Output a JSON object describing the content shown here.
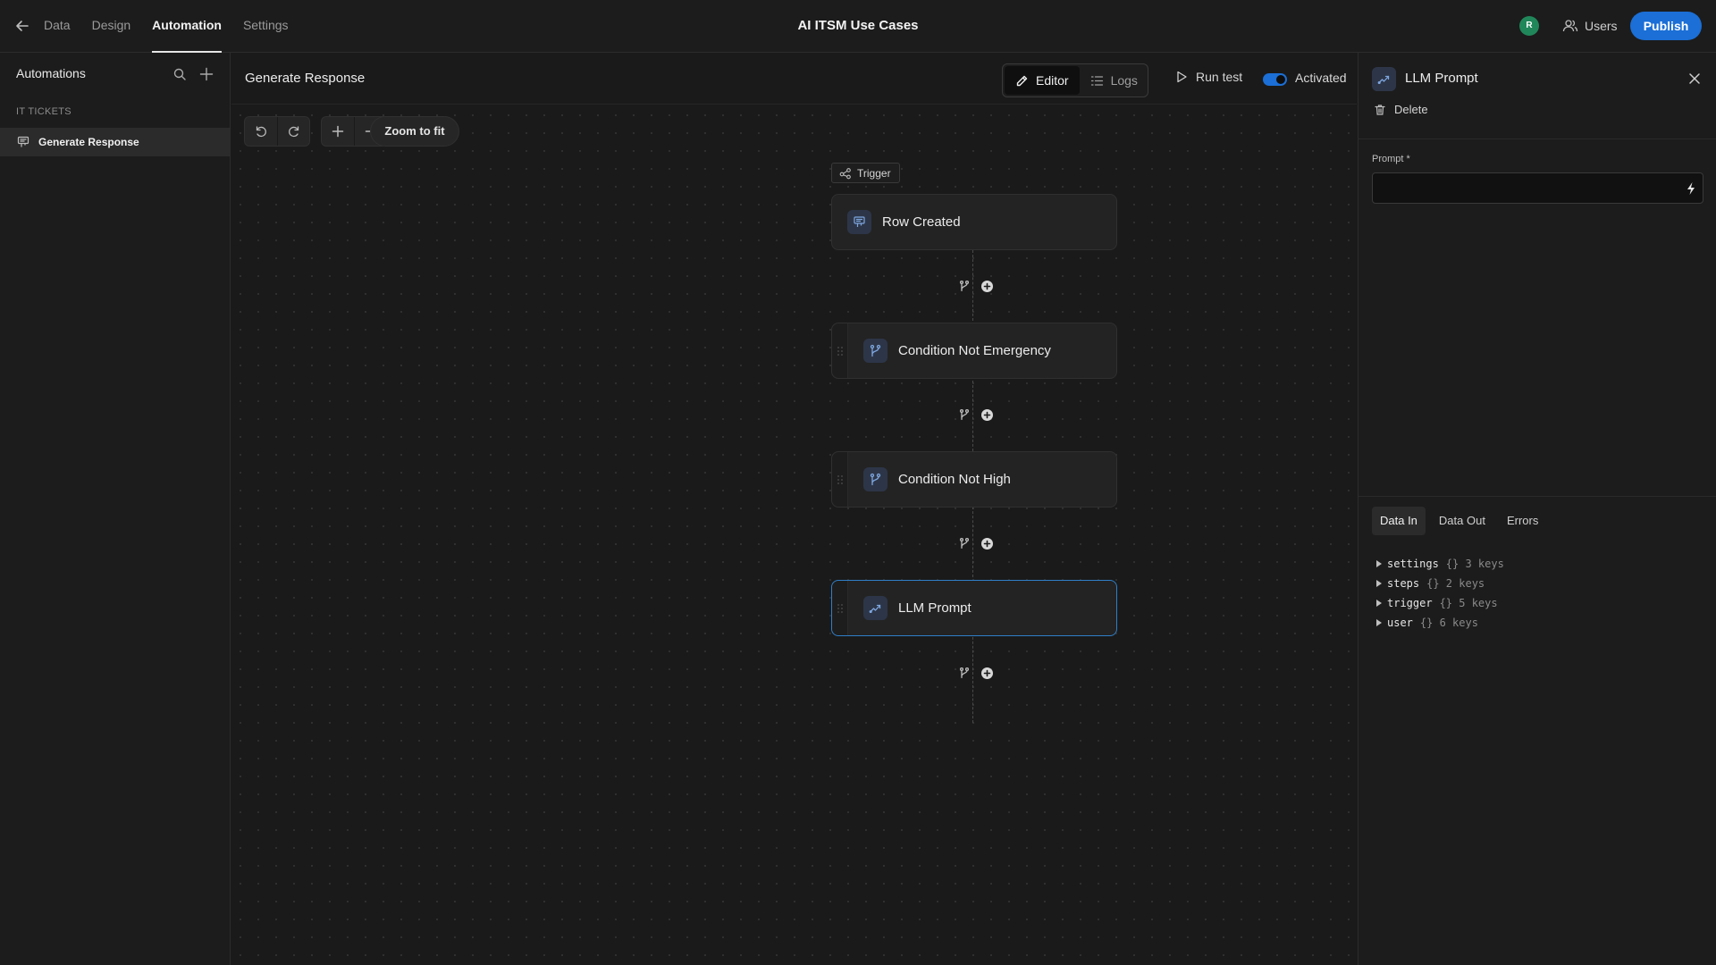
{
  "header": {
    "title": "AI ITSM Use Cases",
    "nav_tabs": [
      "Data",
      "Design",
      "Automation",
      "Settings"
    ],
    "active_tab": "Automation",
    "avatar_initial": "R",
    "users_label": "Users",
    "publish_label": "Publish"
  },
  "sidebar": {
    "title": "Automations",
    "section": "IT TICKETS",
    "items": [
      {
        "label": "Generate Response"
      }
    ]
  },
  "canvas": {
    "title": "Generate Response",
    "editor_label": "Editor",
    "logs_label": "Logs",
    "run_test_label": "Run test",
    "activated_label": "Activated",
    "activated": true,
    "zoom_to_fit_label": "Zoom to fit",
    "trigger_tag": "Trigger",
    "nodes": [
      {
        "label": "Row Created",
        "icon": "table-row-icon"
      },
      {
        "label": "Condition Not Emergency",
        "icon": "branch-icon"
      },
      {
        "label": "Condition Not High",
        "icon": "branch-icon"
      },
      {
        "label": "LLM Prompt",
        "icon": "llm-icon",
        "selected": true
      }
    ]
  },
  "panel": {
    "title": "LLM Prompt",
    "delete_label": "Delete",
    "prompt_label": "Prompt *",
    "prompt_value": "",
    "tabs": [
      "Data In",
      "Data Out",
      "Errors"
    ],
    "active_tab": "Data In",
    "data_in": [
      {
        "key": "settings",
        "meta": "{} 3 keys"
      },
      {
        "key": "steps",
        "meta": "{} 2 keys"
      },
      {
        "key": "trigger",
        "meta": "{} 5 keys"
      },
      {
        "key": "user",
        "meta": "{} 6 keys"
      }
    ]
  },
  "colors": {
    "accent": "#1b6fd6",
    "avatar": "#20875a",
    "selected_border": "#2f7ec7",
    "background": "#1a1a1a"
  }
}
